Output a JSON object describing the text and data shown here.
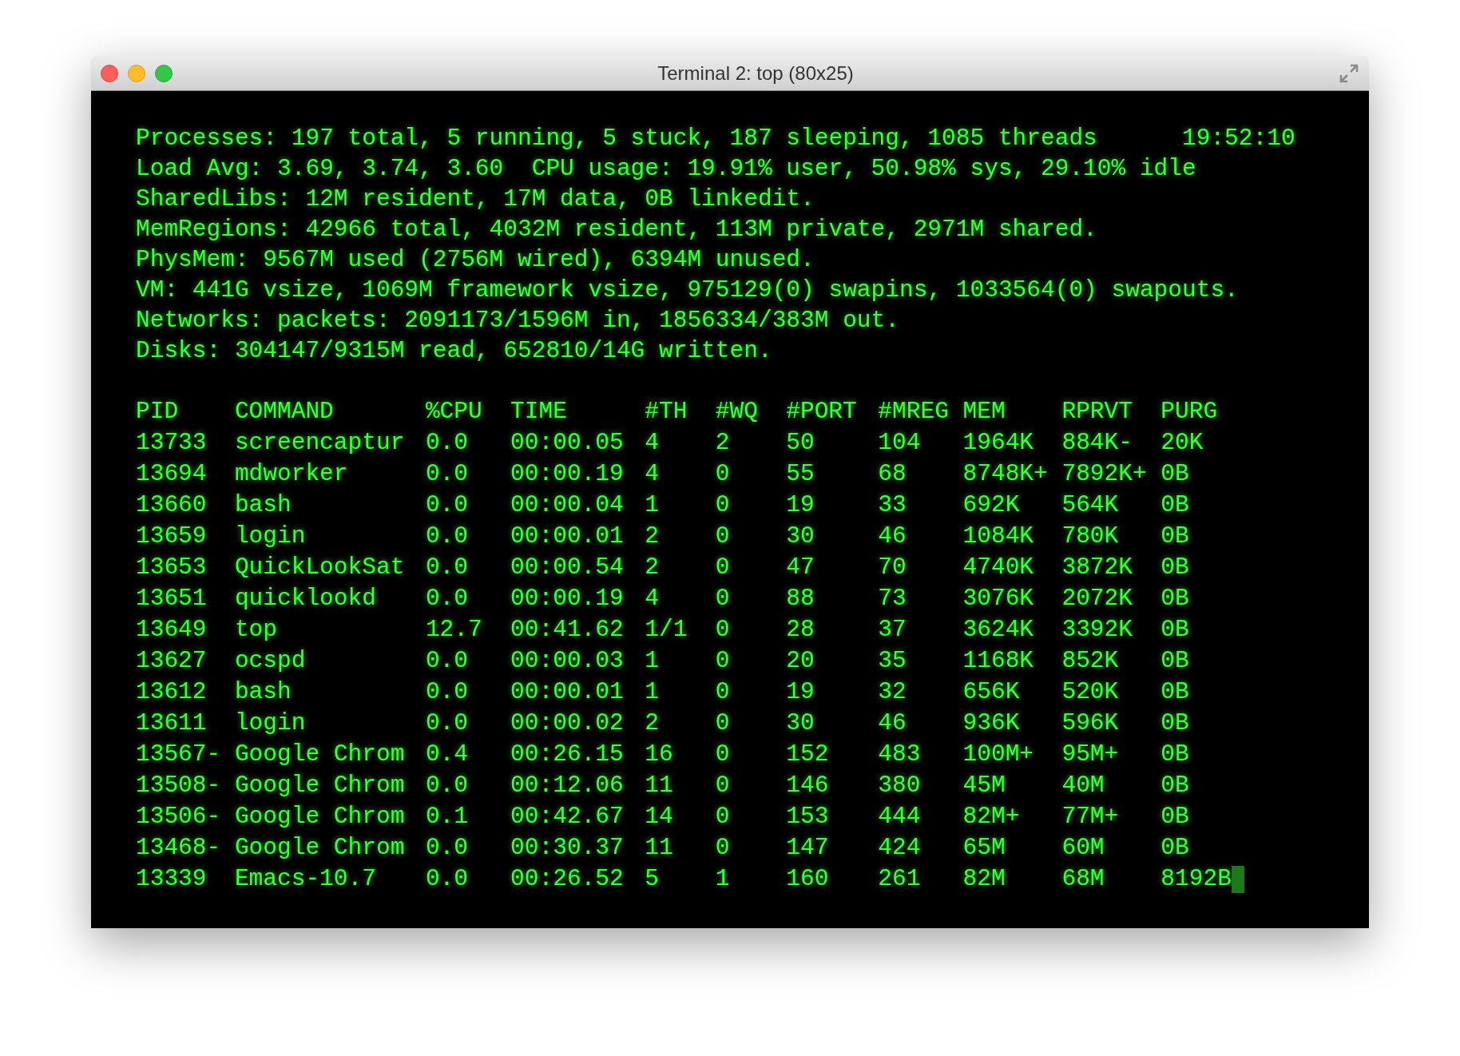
{
  "window": {
    "title": "Terminal 2: top (80x25)"
  },
  "summary": {
    "lines": [
      "Processes: 197 total, 5 running, 5 stuck, 187 sleeping, 1085 threads",
      "Load Avg: 3.69, 3.74, 3.60  CPU usage: 19.91% user, 50.98% sys, 29.10% idle",
      "SharedLibs: 12M resident, 17M data, 0B linkedit.",
      "MemRegions: 42966 total, 4032M resident, 113M private, 2971M shared.",
      "PhysMem: 9567M used (2756M wired), 6394M unused.",
      "VM: 441G vsize, 1069M framework vsize, 975129(0) swapins, 1033564(0) swapouts.",
      "Networks: packets: 2091173/1596M in, 1856334/383M out.",
      "Disks: 304147/9315M read, 652810/14G written."
    ],
    "clock": "19:52:10"
  },
  "table": {
    "columns": [
      "PID",
      "COMMAND",
      "%CPU",
      "TIME",
      "#TH",
      "#WQ",
      "#PORT",
      "#MREG",
      "MEM",
      "RPRVT",
      "PURG"
    ],
    "rows": [
      [
        "13733",
        "screencaptur",
        "0.0",
        "00:00.05",
        "4",
        "2",
        "50",
        "104",
        "1964K",
        "884K-",
        "20K"
      ],
      [
        "13694",
        "mdworker",
        "0.0",
        "00:00.19",
        "4",
        "0",
        "55",
        "68",
        "8748K+",
        "7892K+",
        "0B"
      ],
      [
        "13660",
        "bash",
        "0.0",
        "00:00.04",
        "1",
        "0",
        "19",
        "33",
        "692K",
        "564K",
        "0B"
      ],
      [
        "13659",
        "login",
        "0.0",
        "00:00.01",
        "2",
        "0",
        "30",
        "46",
        "1084K",
        "780K",
        "0B"
      ],
      [
        "13653",
        "QuickLookSat",
        "0.0",
        "00:00.54",
        "2",
        "0",
        "47",
        "70",
        "4740K",
        "3872K",
        "0B"
      ],
      [
        "13651",
        "quicklookd",
        "0.0",
        "00:00.19",
        "4",
        "0",
        "88",
        "73",
        "3076K",
        "2072K",
        "0B"
      ],
      [
        "13649",
        "top",
        "12.7",
        "00:41.62",
        "1/1",
        "0",
        "28",
        "37",
        "3624K",
        "3392K",
        "0B"
      ],
      [
        "13627",
        "ocspd",
        "0.0",
        "00:00.03",
        "1",
        "0",
        "20",
        "35",
        "1168K",
        "852K",
        "0B"
      ],
      [
        "13612",
        "bash",
        "0.0",
        "00:00.01",
        "1",
        "0",
        "19",
        "32",
        "656K",
        "520K",
        "0B"
      ],
      [
        "13611",
        "login",
        "0.0",
        "00:00.02",
        "2",
        "0",
        "30",
        "46",
        "936K",
        "596K",
        "0B"
      ],
      [
        "13567-",
        "Google Chrom",
        "0.4",
        "00:26.15",
        "16",
        "0",
        "152",
        "483",
        "100M+",
        "95M+",
        "0B"
      ],
      [
        "13508-",
        "Google Chrom",
        "0.0",
        "00:12.06",
        "11",
        "0",
        "146",
        "380",
        "45M",
        "40M",
        "0B"
      ],
      [
        "13506-",
        "Google Chrom",
        "0.1",
        "00:42.67",
        "14",
        "0",
        "153",
        "444",
        "82M+",
        "77M+",
        "0B"
      ],
      [
        "13468-",
        "Google Chrom",
        "0.0",
        "00:30.37",
        "11",
        "0",
        "147",
        "424",
        "65M",
        "60M",
        "0B"
      ],
      [
        "13339",
        "Emacs-10.7",
        "0.0",
        "00:26.52",
        "5",
        "1",
        "160",
        "261",
        "82M",
        "68M",
        "8192B"
      ]
    ]
  }
}
